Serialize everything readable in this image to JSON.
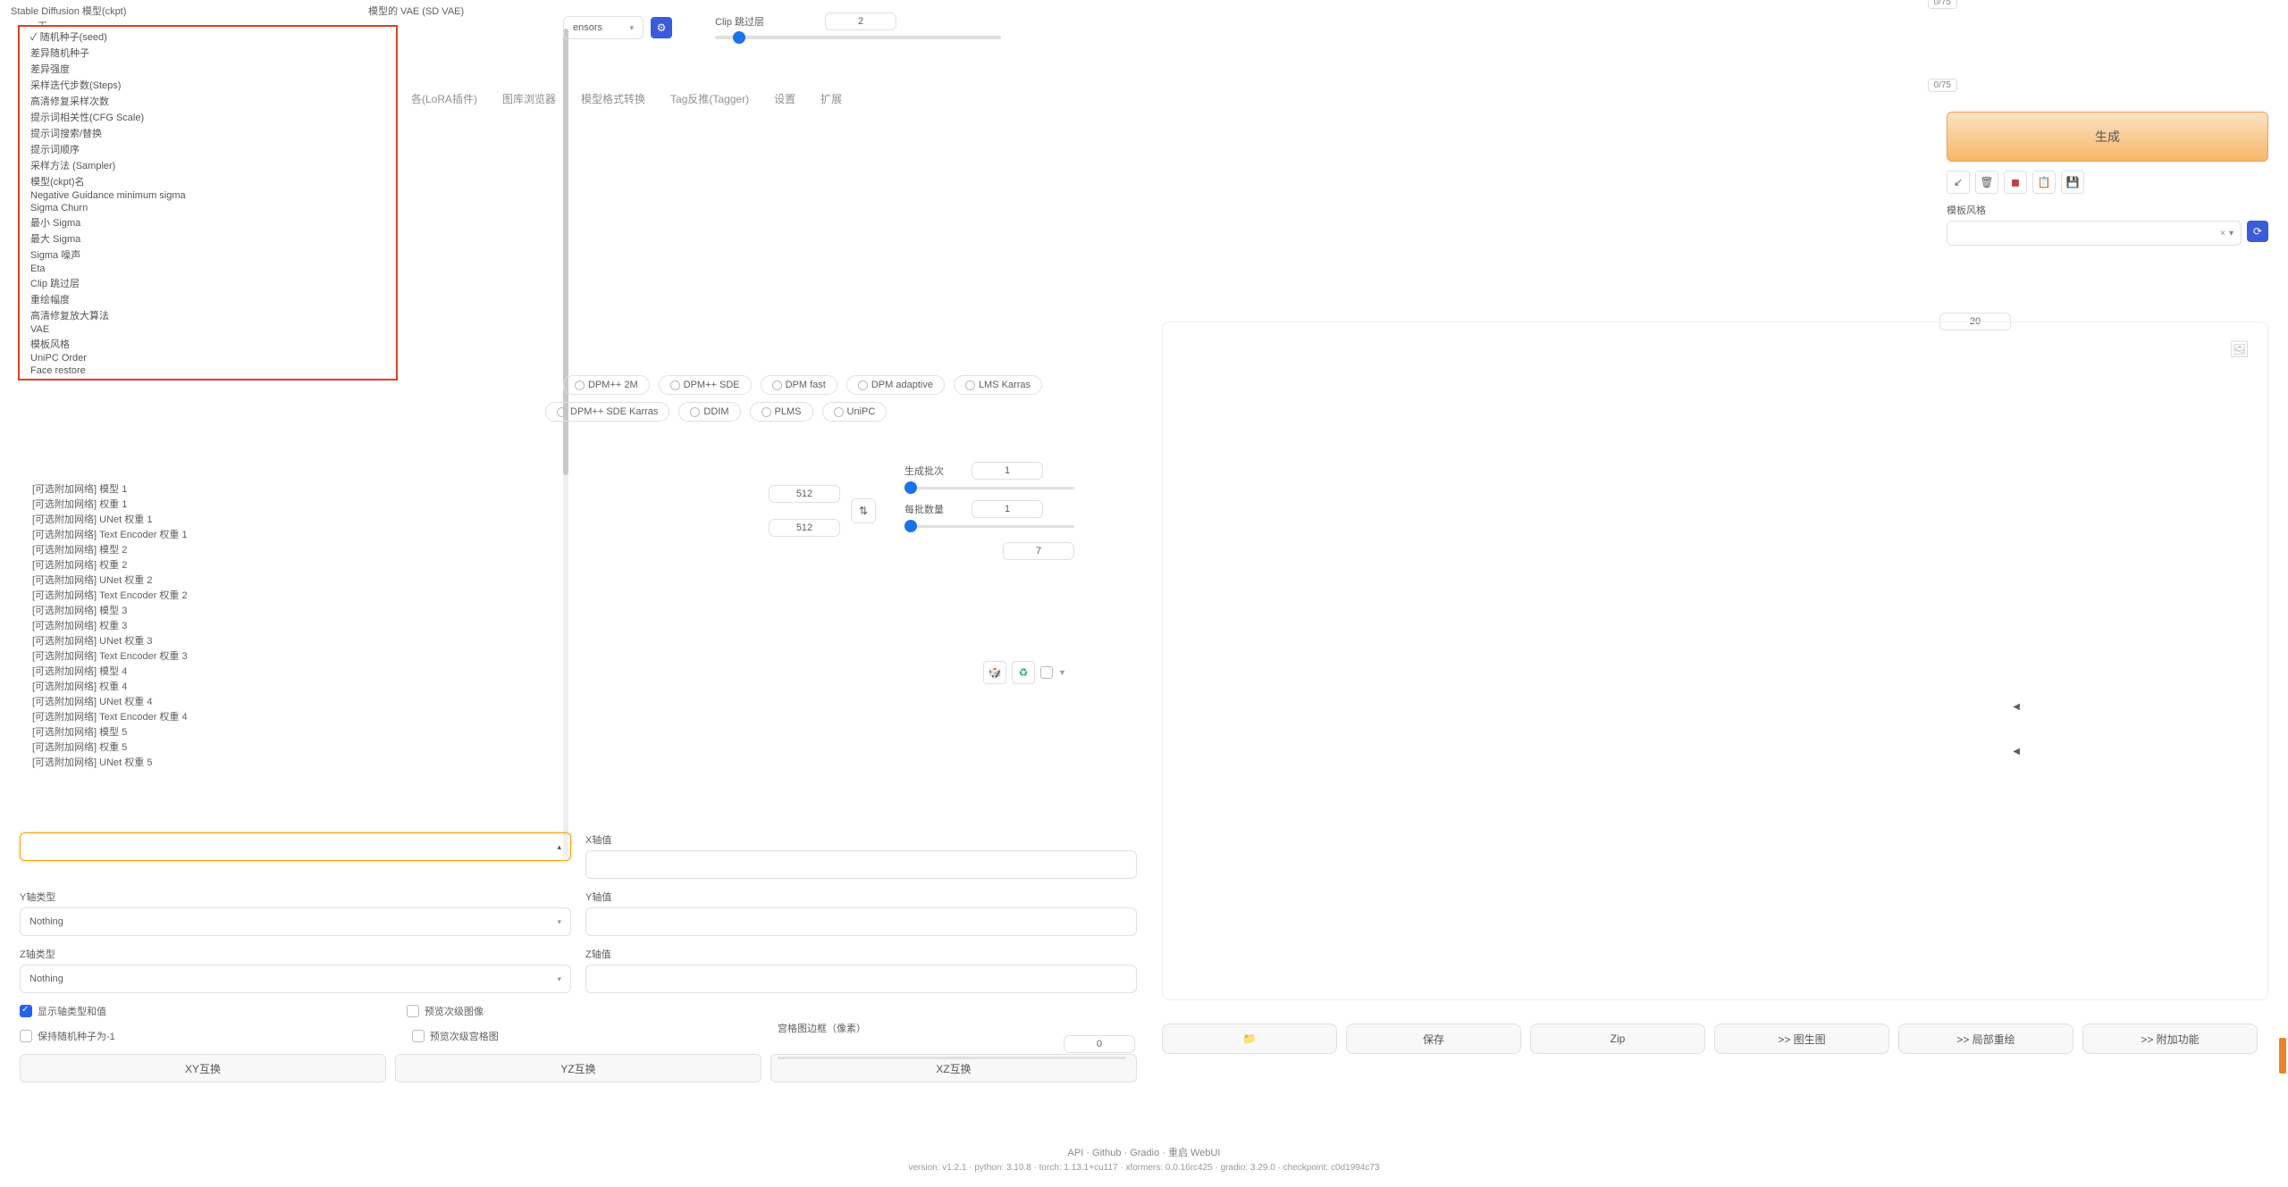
{
  "header": {
    "model_label": "Stable Diffusion 模型(ckpt)",
    "vae_label": "模型的 VAE (SD VAE)",
    "none": "无",
    "tensors": "ensors",
    "clip_label": "Clip 跳过层",
    "clip_value": "2"
  },
  "dropdown_options": [
    "随机种子(seed)",
    "差异随机种子",
    "差异强度",
    "采样迭代步数(Steps)",
    "高清修复采样次数",
    "提示词相关性(CFG Scale)",
    "提示词搜索/替换",
    "提示词顺序",
    "采样方法 (Sampler)",
    "模型(ckpt)名",
    "Negative Guidance minimum sigma",
    "Sigma Churn",
    "最小 Sigma",
    "最大 Sigma",
    "Sigma 噪声",
    "Eta",
    "Clip 跳过层",
    "重绘幅度",
    "高清修复放大算法",
    "VAE",
    "模板风格",
    "UniPC Order",
    "Face restore"
  ],
  "addon_options": [
    "[可选附加网络] 模型 1",
    "[可选附加网络] 权重 1",
    "[可选附加网络] UNet 权重 1",
    "[可选附加网络] Text Encoder 权重 1",
    "[可选附加网络] 模型 2",
    "[可选附加网络] 权重 2",
    "[可选附加网络] UNet 权重 2",
    "[可选附加网络] Text Encoder 权重 2",
    "[可选附加网络] 模型 3",
    "[可选附加网络] 权重 3",
    "[可选附加网络] UNet 权重 3",
    "[可选附加网络] Text Encoder 权重 3",
    "[可选附加网络] 模型 4",
    "[可选附加网络] 权重 4",
    "[可选附加网络] UNet 权重 4",
    "[可选附加网络] Text Encoder 权重 4",
    "[可选附加网络] 模型 5",
    "[可选附加网络] 权重 5",
    "[可选附加网络] UNet 权重 5"
  ],
  "tabs": [
    "各(LoRA插件)",
    "图库浏览器",
    "模型格式转换",
    "Tag反推(Tagger)",
    "设置",
    "扩展"
  ],
  "counter": "0/75",
  "generate": "生成",
  "style_label": "模板风格",
  "steps_value": "20",
  "samplers_row1": [
    "DPM++ 2M",
    "DPM++ SDE",
    "DPM fast",
    "DPM adaptive",
    "LMS Karras"
  ],
  "samplers_row2": [
    "DPM++ SDE Karras",
    "DDIM",
    "PLMS",
    "UniPC"
  ],
  "dims": {
    "width": "512",
    "height": "512"
  },
  "batch": {
    "count_label": "生成批次",
    "count_val": "1",
    "size_label": "每批数量",
    "size_val": "1",
    "cfg_val": "7"
  },
  "xyz": {
    "x_val_label": "X轴值",
    "y_type_label": "Y轴类型",
    "y_val_label": "Y轴值",
    "z_type_label": "Z轴类型",
    "z_val_label": "Z轴值",
    "nothing": "Nothing"
  },
  "checks": {
    "show_axis": "显示轴类型和值",
    "preview_sub": "预览次级图像",
    "keep_seed": "保持随机种子为-1",
    "preview_grid": "预览次级宫格图"
  },
  "grid_margin": {
    "label": "宫格图边框（像素）",
    "val": "0"
  },
  "swaps": {
    "xy": "XY互换",
    "yz": "YZ互换",
    "xz": "XZ互换"
  },
  "actions": {
    "folder": "📁",
    "save": "保存",
    "zip": "Zip",
    "img2img": ">> 图生图",
    "inpaint": ">> 局部重绘",
    "extras": ">> 附加功能"
  },
  "footer": {
    "links": "API · Github · Gradio · 重启 WebUI",
    "version": "version: v1.2.1  ·  python: 3.10.8  ·  torch: 1.13.1+cu117  ·  xformers: 0.0.16rc425  ·  gradio: 3.29.0  ·  checkpoint: c0d1994c73"
  }
}
